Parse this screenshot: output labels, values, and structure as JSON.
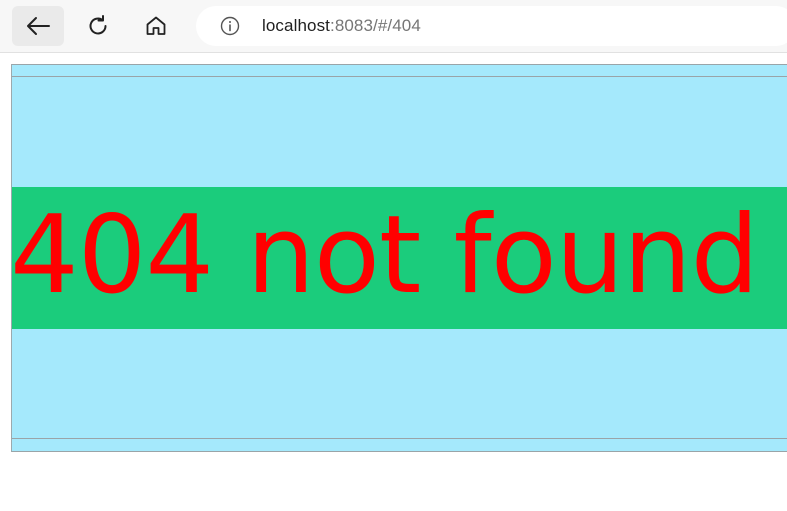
{
  "browser": {
    "address": {
      "host": "localhost",
      "rest": ":8083/#/404"
    },
    "icons": {
      "back": "arrow-left-icon",
      "refresh": "refresh-icon",
      "home": "home-icon",
      "info": "info-icon"
    }
  },
  "page": {
    "message": "404 not found",
    "colors": {
      "background": "#a5e9fc",
      "banner": "#1bcc7c",
      "text": "#ff0000"
    }
  }
}
